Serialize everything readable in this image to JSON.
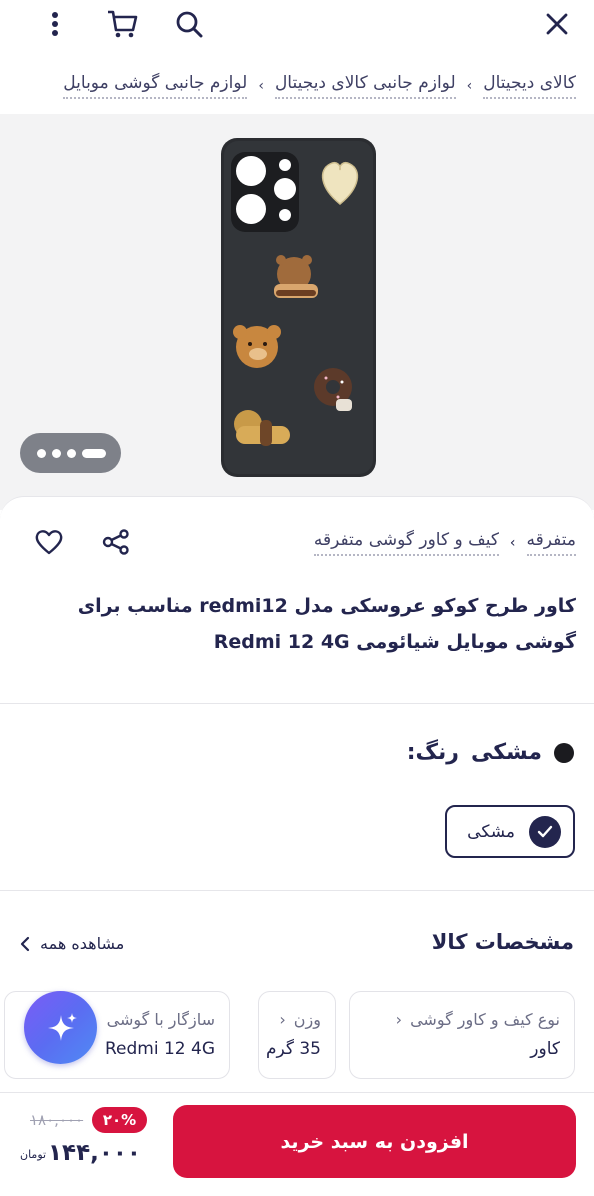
{
  "breadcrumb": [
    "کالای دیجیتال",
    "لوازم جانبی کالای دیجیتال",
    "لوازم جانبی گوشی موبایل"
  ],
  "gallery": {
    "slide_index": 1,
    "slide_count": 4
  },
  "categories": [
    "متفرقه",
    "کیف و کاور گوشی متفرقه"
  ],
  "product": {
    "title": "کاور طرح کوکو عروسکی مدل redmi12 مناسب برای گوشی موبایل شیائومی Redmi 12 4G"
  },
  "color": {
    "label": "رنگ:",
    "value": "مشکی",
    "swatch_hex": "#1b1b1f",
    "options": [
      {
        "name": "مشکی",
        "selected": true
      }
    ]
  },
  "specs": {
    "heading": "مشخصات کالا",
    "see_all": "مشاهده همه",
    "items": [
      {
        "key": "نوع کیف و کاور گوشی",
        "value": "کاور"
      },
      {
        "key": "وزن",
        "value": "35 گرم"
      },
      {
        "key": "سازگار با گوشی",
        "value": "Redmi 12 4G"
      }
    ]
  },
  "pricing": {
    "add_to_cart": "افزودن به سبد خرید",
    "old_price": "۱۸۰,۰۰۰",
    "discount": "۲۰%",
    "price": "۱۴۴,۰۰۰",
    "currency": "تومان"
  },
  "colors": {
    "accent": "#d7143f",
    "text": "#23254e",
    "fab_start": "#7b5cf6",
    "fab_end": "#4f8bf4"
  },
  "icons": [
    "close-icon",
    "search-icon",
    "cart-icon",
    "more-icon",
    "share-icon",
    "heart-icon",
    "check-icon",
    "chevron-icon",
    "sparkle-icon"
  ]
}
